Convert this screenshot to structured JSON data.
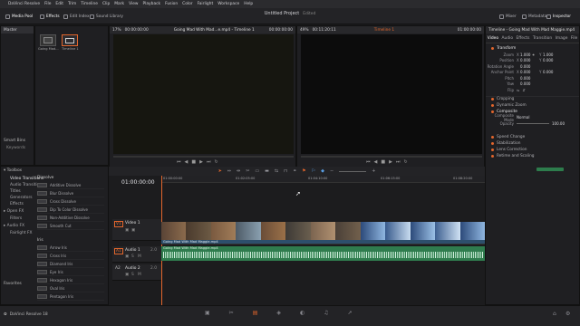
{
  "menubar": {
    "apple": "",
    "items": [
      "DaVinci Resolve",
      "File",
      "Edit",
      "Trim",
      "Timeline",
      "Clip",
      "Mark",
      "View",
      "Playback",
      "Fusion",
      "Color",
      "Fairlight",
      "Workspace",
      "Help"
    ]
  },
  "toolbar": {
    "media_pool": "Media Pool",
    "effects": "Effects",
    "edit_index": "Edit Index",
    "sound_library": "Sound Library",
    "project_title": "Untitled Project",
    "project_status": "Edited",
    "mixer": "Mixer",
    "metadata": "Metadata",
    "inspector": "Inspector"
  },
  "media_pool": {
    "bin_master": "Master",
    "clip1": "Going Mad...",
    "clip2": "Timeline 1",
    "smart_bins": "Smart Bins",
    "keywords": "Keywords"
  },
  "source_viewer": {
    "zoom": "17%",
    "timecode_left": "00:00:00:00",
    "clip_name": "Going Mad With Mad...e.mp4 - Timeline 1",
    "timecode_right": "00:00:00:00"
  },
  "timeline_viewer": {
    "zoom": "49%",
    "duration": "00:11:20:11",
    "timeline_name": "Timeline 1",
    "timecode_right": "01:00:00:00"
  },
  "inspector": {
    "title": "Timeline - Going Mad With Mad Maggie.mp4",
    "tabs": [
      "Video",
      "Audio",
      "Effects",
      "Transition",
      "Image",
      "File"
    ],
    "transform": "Transform",
    "zoom_label": "Zoom",
    "zoom_x": "1.000",
    "zoom_y": "1.000",
    "position_label": "Position",
    "pos_x": "0.000",
    "pos_y": "0.000",
    "rotation_label": "Rotation Angle",
    "rotation": "0.000",
    "anchor_label": "Anchor Point",
    "anchor_x": "0.000",
    "anchor_y": "0.000",
    "pitch_label": "Pitch",
    "pitch": "0.000",
    "yaw_label": "Yaw",
    "yaw": "0.000",
    "flip_label": "Flip",
    "cropping": "Cropping",
    "dynamic_zoom": "Dynamic Zoom",
    "composite": "Composite",
    "composite_mode_label": "Composite Mode",
    "composite_mode": "Normal",
    "opacity_label": "Opacity",
    "opacity": "100.00",
    "speed_change": "Speed Change",
    "stabilization": "Stabilization",
    "lens_correction": "Lens Correction",
    "retime_scaling": "Retime and Scaling"
  },
  "effects": {
    "toolbox": "Toolbox",
    "video_transitions": "Video Transitions",
    "audio_transitions": "Audio Transitions",
    "titles": "Titles",
    "generators": "Generators",
    "effects": "Effects",
    "openfx": "Open FX",
    "filters": "Filters",
    "audio_fx": "Audio FX",
    "fairlight_fx": "Fairlight FX",
    "favorites": "Favorites",
    "dissolve": "Dissolve",
    "items": [
      "Additive Dissolve",
      "Blur Dissolve",
      "Cross Dissolve",
      "Dip To Color Dissolve",
      "Non-Additive Dissolve",
      "Smooth Cut"
    ],
    "iris": "Iris",
    "iris_items": [
      "Arrow Iris",
      "Cross Iris",
      "Diamond Iris",
      "Eye Iris",
      "Hexagon Iris",
      "Oval Iris",
      "Pentagon Iris"
    ]
  },
  "timeline": {
    "timecode": "01:00:00:00",
    "v1_label": "V1",
    "v1_name": "Video 1",
    "a1_label": "A1",
    "a1_name": "Audio 1",
    "a1_level": "2.0",
    "a2_label": "A2",
    "a2_name": "Audio 2",
    "a2_level": "2.0",
    "clip_name": "Going Mad With Mad Maggie.mp4",
    "ruler_marks": [
      "01:00:00:00",
      "01:02:05:00",
      "01:04:10:00",
      "01:06:15:00",
      "01:08:20:00"
    ]
  },
  "statusbar": {
    "app_name": "DaVinci Resolve 18"
  }
}
